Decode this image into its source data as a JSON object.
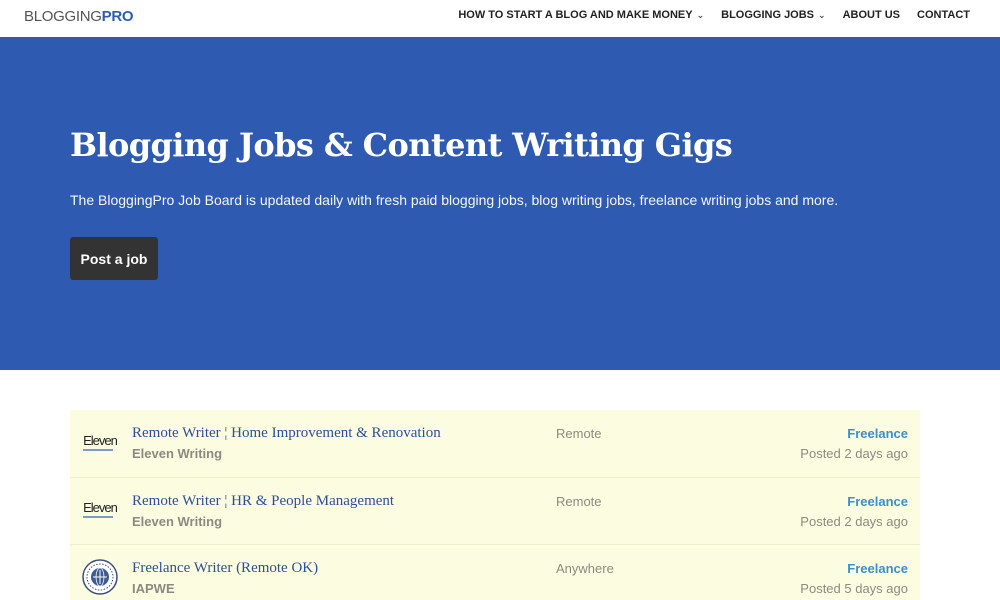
{
  "header": {
    "logo_main": "BLOGGING",
    "logo_accent": "PRO",
    "nav": [
      {
        "label": "HOW TO START A BLOG AND MAKE MONEY",
        "has_dropdown": true
      },
      {
        "label": "BLOGGING JOBS",
        "has_dropdown": true
      },
      {
        "label": "ABOUT US",
        "has_dropdown": false
      },
      {
        "label": "CONTACT",
        "has_dropdown": false
      }
    ],
    "caret": "⌄"
  },
  "hero": {
    "title": "Blogging Jobs & Content Writing Gigs",
    "description": "The BloggingPro Job Board is updated daily with fresh paid blogging jobs, blog writing jobs, freelance writing jobs and more.",
    "button_label": "Post a job",
    "background_color": "#2f5ab1"
  },
  "jobs": [
    {
      "logo": "Eleven",
      "title": "Remote Writer ¦ Home Improvement & Renovation",
      "company": "Eleven Writing",
      "location": "Remote",
      "type": "Freelance",
      "posted": "Posted 2 days ago"
    },
    {
      "logo": "Eleven",
      "title": "Remote Writer ¦ HR & People Management",
      "company": "Eleven Writing",
      "location": "Remote",
      "type": "Freelance",
      "posted": "Posted 2 days ago"
    },
    {
      "logo": "seal-icon",
      "title": "Freelance Writer (Remote OK)",
      "company": "IAPWE",
      "location": "Anywhere",
      "type": "Freelance",
      "posted": "Posted 5 days ago"
    }
  ],
  "colors": {
    "brand": "#2f5db1",
    "job_row_bg": "#fcfde0",
    "job_type": "#3a8fd0",
    "job_title": "#2d4f9a"
  }
}
